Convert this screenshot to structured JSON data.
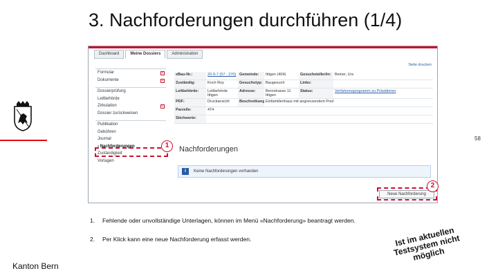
{
  "slide": {
    "title": "3. Nachforderungen durchführen (1/4)",
    "canton": "Kanton Bern",
    "page_number": "58"
  },
  "app": {
    "tabs": [
      {
        "label": "Dashboard"
      },
      {
        "label": "Meine Dossiers"
      },
      {
        "label": "Administration"
      }
    ],
    "print_link": "Seite drucken",
    "sidebar": {
      "group1": [
        {
          "label": "Formular"
        },
        {
          "label": "Dokumente"
        }
      ],
      "group2": [
        {
          "label": "Dossierprüfung"
        },
        {
          "label": "Leitbehörde"
        },
        {
          "label": "Zirkulation"
        },
        {
          "label": "Dossier zurückweisen"
        }
      ],
      "group3": [
        {
          "label": "Publikation"
        },
        {
          "label": "Gebühren"
        },
        {
          "label": "Journal"
        },
        {
          "label": "› Nachforderungen"
        },
        {
          "label": "Zuständigkeit"
        },
        {
          "label": "Vorlagen"
        }
      ]
    },
    "details": [
      [
        "eBau-Nr.:",
        "20-9-7 (57 · 270)",
        "Gemeinde:",
        "Ittigen (404)",
        "Gesuchsteller/in:",
        "Beiner, Urs"
      ],
      [
        "Zuständig:",
        "Koch Roy",
        "Gesuchstyp:",
        "Baugesuch",
        "Links:",
        ""
      ],
      [
        "Leitbehörde:",
        "Leitbehörde Ittigen",
        "Adresse:",
        "Bernstrasse 11 Ittigen",
        "Status:",
        "Verfahrensprogramm zu Präsidieren"
      ],
      [
        "PDF:",
        "Druckansicht",
        "Beschreibung:",
        "Einfamilienhaus mit angrenzendem Pool",
        "",
        ""
      ],
      [
        "Parzelle:",
        "474",
        "",
        "",
        "",
        ""
      ],
      [
        "Stichworte:",
        "",
        "",
        "",
        "",
        ""
      ]
    ],
    "section_title": "Nachforderungen",
    "info_message": "Keine Nachforderungen vorhanden",
    "new_button": "Neue Nachforderung"
  },
  "markers": {
    "one": "1",
    "two": "2"
  },
  "steps": [
    {
      "num": "1.",
      "text": "Fehlende oder unvollständige Unterlagen, können im Menü «Nachforderung» beantragt werden."
    },
    {
      "num": "2.",
      "text": "Per Klick kann eine neue Nachforderung erfasst werden."
    }
  ],
  "stamp": {
    "line1": "Ist im aktuellen",
    "line2": "Testsystem nicht",
    "line3": "möglich"
  },
  "colors": {
    "accent_red": "#c8102e",
    "link_blue": "#2a5aa7"
  }
}
